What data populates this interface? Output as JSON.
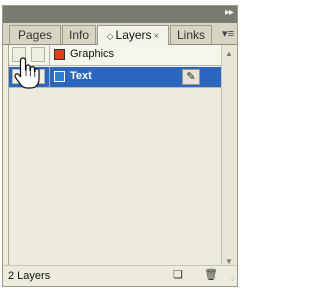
{
  "tabs": [
    {
      "label": "Pages"
    },
    {
      "label": "Info"
    },
    {
      "label": "Layers"
    },
    {
      "label": "Links"
    }
  ],
  "icons": {
    "collapse": "collapse-double-arrow-icon",
    "panel_menu": "panel-menu-icon",
    "layers_tab": "layers-tab-icon",
    "close": "close-icon",
    "pen": "pen-icon",
    "new_layer": "new-layer-icon",
    "delete": "trash-icon",
    "cursor": "hand-cursor-icon",
    "scroll_up": "scroll-up-icon",
    "scroll_down": "scroll-down-icon",
    "resize": "resize-grip-icon"
  },
  "layers": [
    {
      "name": "Graphics",
      "color": "#e0401c",
      "selected": false
    },
    {
      "name": "Text",
      "color": "#2f7fd6",
      "selected": true
    }
  ],
  "status": {
    "text": "2 Layers"
  },
  "colors": {
    "selection": "#2d66bf",
    "panel_bg": "#ecebdc"
  }
}
